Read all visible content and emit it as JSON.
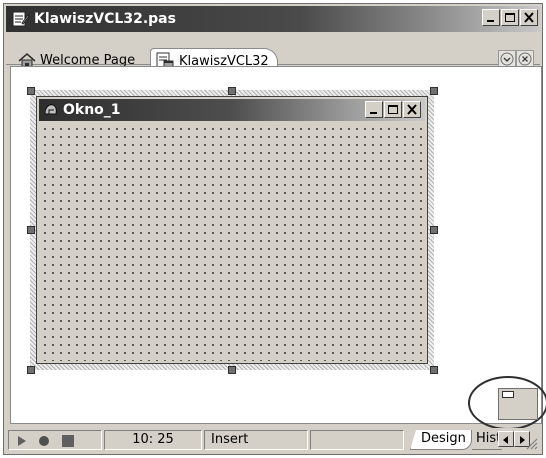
{
  "window": {
    "title": "KlawiszVCL32.pas",
    "minimize_label": "_",
    "maximize_label": "□",
    "close_label": "X"
  },
  "tabs": [
    {
      "label": "Welcome Page",
      "icon": "house-icon",
      "active": false
    },
    {
      "label": "KlawiszVCL32",
      "icon": "form-file-icon",
      "active": true
    }
  ],
  "designer": {
    "form_title": "Okno_1",
    "grid": true
  },
  "statusbar": {
    "position": "10: 25",
    "mode": "Insert",
    "view_tabs": [
      {
        "label": "Design",
        "active": true
      },
      {
        "label": "History",
        "active": false
      }
    ]
  },
  "colors": {
    "face": "#d4d0c8",
    "title_dark": "#303030",
    "design_bg": "#ffffff"
  }
}
